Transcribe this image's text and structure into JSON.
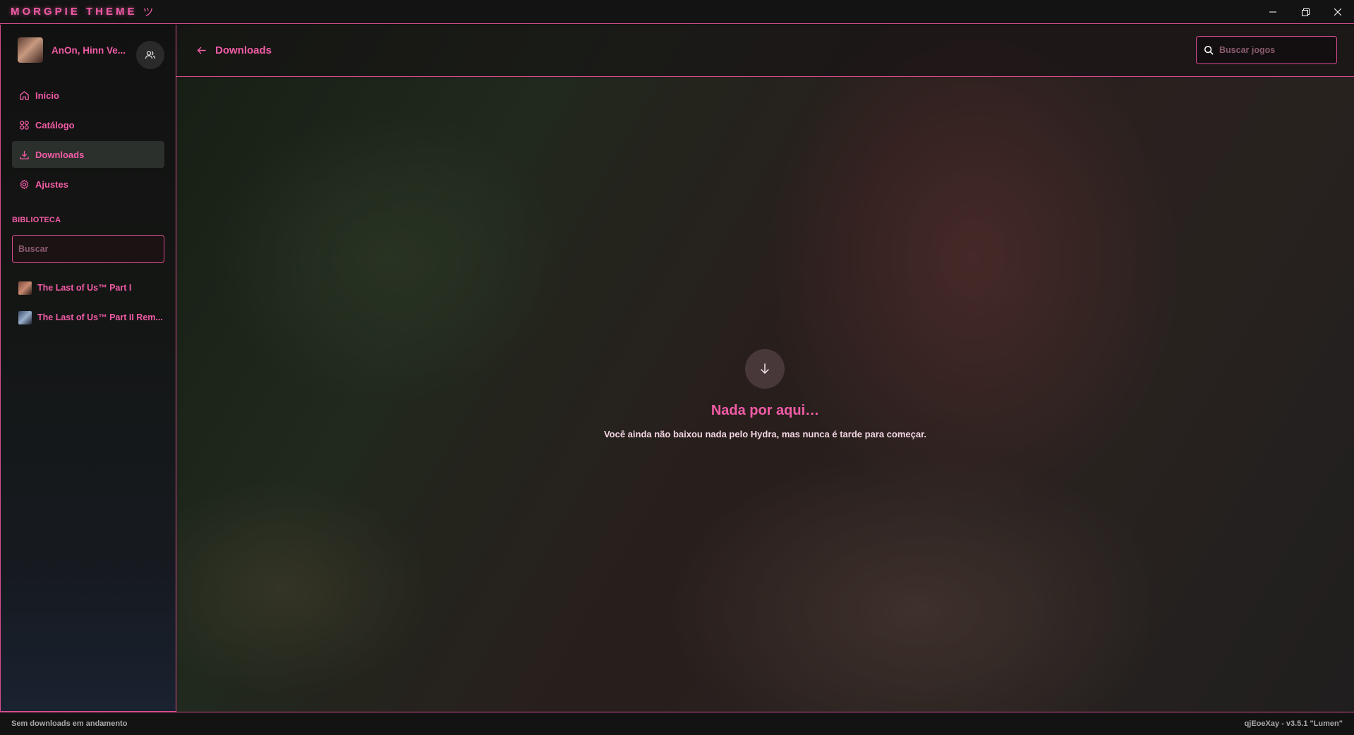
{
  "window": {
    "title": "MORGPIE THEME",
    "title_mark": "ツ",
    "controls": {
      "minimize": "—",
      "restore": "❐",
      "close": "✕"
    }
  },
  "profile": {
    "name": "AnOn, Hinn Ve...",
    "friends_icon": "users-icon"
  },
  "sidebar": {
    "nav": [
      {
        "label": "Início",
        "icon": "home-icon",
        "active": false
      },
      {
        "label": "Catálogo",
        "icon": "grid-icon",
        "active": false
      },
      {
        "label": "Downloads",
        "icon": "download-icon",
        "active": true
      },
      {
        "label": "Ajustes",
        "icon": "gear-icon",
        "active": false
      }
    ],
    "library_title": "BIBLIOTECA",
    "library_search_placeholder": "Buscar",
    "games": [
      {
        "label": "The Last of Us™ Part I"
      },
      {
        "label": "The Last of Us™ Part II Rem..."
      }
    ]
  },
  "header": {
    "back_icon": "arrow-left-icon",
    "title": "Downloads",
    "search_placeholder": "Buscar jogos",
    "search_icon": "search-icon"
  },
  "empty_state": {
    "icon": "arrow-down-icon",
    "title": "Nada por aqui…",
    "text": "Você ainda não baixou nada pelo Hydra, mas nunca é tarde para começar."
  },
  "statusbar": {
    "left": "Sem downloads em andamento",
    "right": "qjEoeXay - v3.5.1 \"Lumen\""
  },
  "colors": {
    "accent": "#f25ca6",
    "border": "#d94c90",
    "background": "#141414"
  }
}
